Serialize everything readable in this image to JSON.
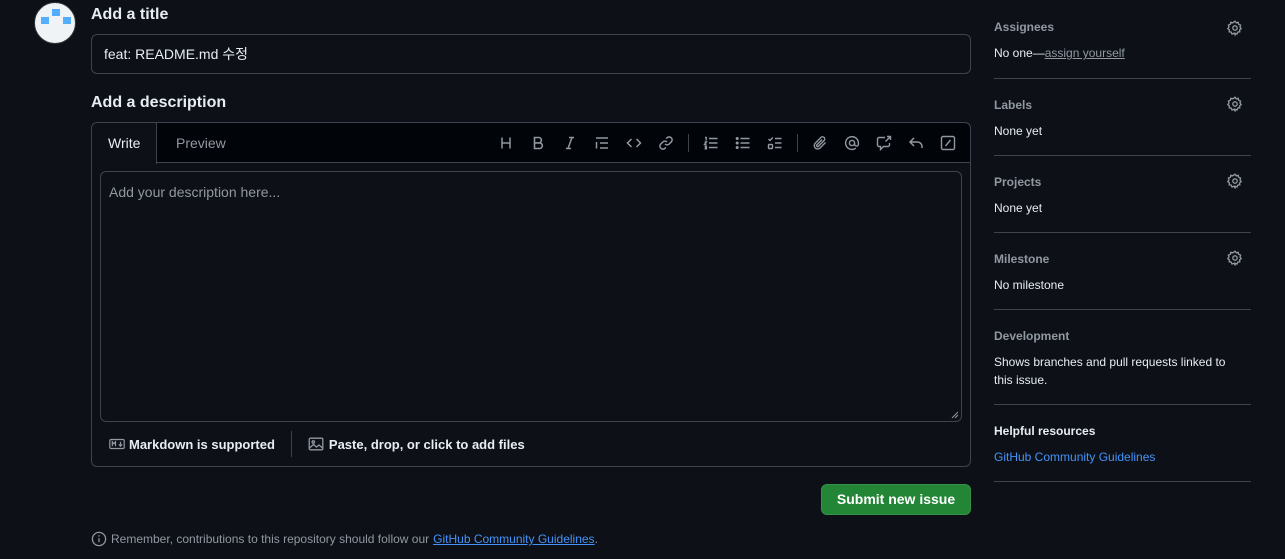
{
  "title_section": {
    "heading": "Add a title",
    "value": "feat: README.md 수정"
  },
  "description_section": {
    "heading": "Add a description",
    "tabs": {
      "write": "Write",
      "preview": "Preview"
    },
    "placeholder": "Add your description here...",
    "toolbar_icons": [
      "heading-icon",
      "bold-icon",
      "italic-icon",
      "quote-icon",
      "code-icon",
      "link-icon",
      "ordered-list-icon",
      "unordered-list-icon",
      "task-list-icon",
      "attach-icon",
      "mention-icon",
      "cross-reference-icon",
      "reply-icon",
      "slash-commands-icon"
    ],
    "footer": {
      "markdown": "Markdown is supported",
      "files": "Paste, drop, or click to add files"
    }
  },
  "submit_label": "Submit new issue",
  "remember": {
    "text": "Remember, contributions to this repository should follow our",
    "link": "GitHub Community Guidelines",
    "period": "."
  },
  "sidebar": {
    "assignees": {
      "title": "Assignees",
      "value_prefix": "No one—",
      "value_link": "assign yourself"
    },
    "labels": {
      "title": "Labels",
      "value": "None yet"
    },
    "projects": {
      "title": "Projects",
      "value": "None yet"
    },
    "milestone": {
      "title": "Milestone",
      "value": "No milestone"
    },
    "development": {
      "title": "Development",
      "value": "Shows branches and pull requests linked to this issue."
    },
    "helpful": {
      "title": "Helpful resources",
      "link": "GitHub Community Guidelines"
    }
  },
  "colors": {
    "background": "#0d1117",
    "border": "#3d444d",
    "primary_button": "#238636",
    "link": "#4493f8",
    "muted_text": "#9198a1"
  }
}
